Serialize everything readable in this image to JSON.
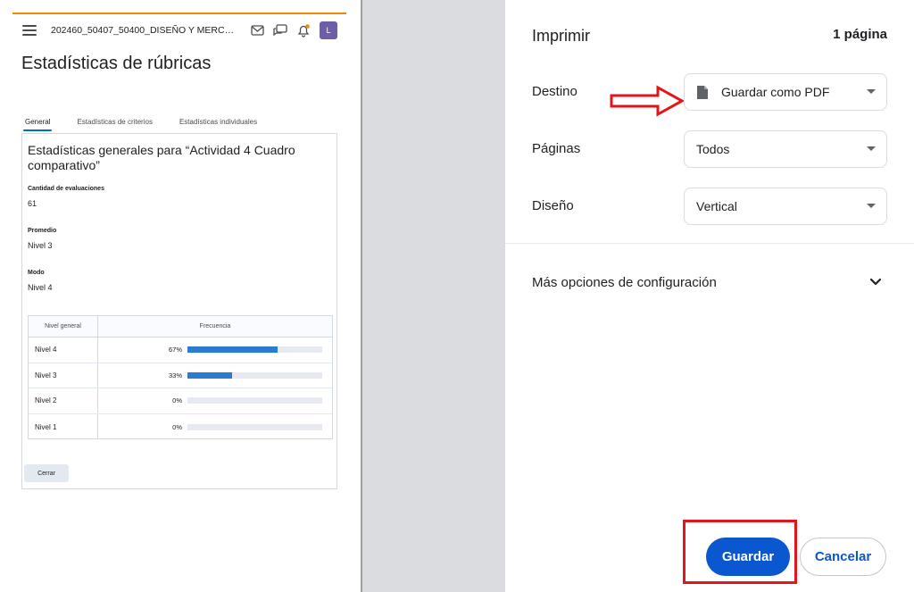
{
  "preview": {
    "nav": {
      "course_title": "202460_50407_50400_DISEÑO Y MERCA...",
      "avatar_initial": "L"
    },
    "page_title": "Estadísticas de rúbricas",
    "tabs": [
      {
        "label": "General",
        "active": true
      },
      {
        "label": "Estadísticas de criterios",
        "active": false
      },
      {
        "label": "Estadísticas individuales",
        "active": false
      }
    ],
    "heading": "Estadísticas generales para “Actividad 4 Cuadro comparativo”",
    "stats": {
      "count_label": "Cantidad de evaluaciones",
      "count_value": "61",
      "average_label": "Promedio",
      "average_value": "Nivel 3",
      "mode_label": "Modo",
      "mode_value": "Nivel 4"
    },
    "table": {
      "headers": [
        "Nivel general",
        "Frecuencia"
      ],
      "rows": [
        {
          "level": "Nivel 4",
          "percent": "67%",
          "fraction": 0.67
        },
        {
          "level": "Nivel 3",
          "percent": "33%",
          "fraction": 0.33
        },
        {
          "level": "Nivel 2",
          "percent": "0%",
          "fraction": 0
        },
        {
          "level": "Nivel 1",
          "percent": "0%",
          "fraction": 0
        }
      ]
    },
    "close_label": "Cerrar",
    "accent_color": "#f08a00",
    "bar_color": "#2b7bd1"
  },
  "dialog": {
    "title": "Imprimir",
    "page_count": "1 página",
    "destination_label": "Destino",
    "destination_value": "Guardar como PDF",
    "pages_label": "Páginas",
    "pages_value": "Todos",
    "layout_label": "Diseño",
    "layout_value": "Vertical",
    "more_options": "Más opciones de configuración",
    "save_label": "Guardar",
    "cancel_label": "Cancelar",
    "primary_color": "#0b57d0",
    "annotation_color": "#e4141b"
  }
}
